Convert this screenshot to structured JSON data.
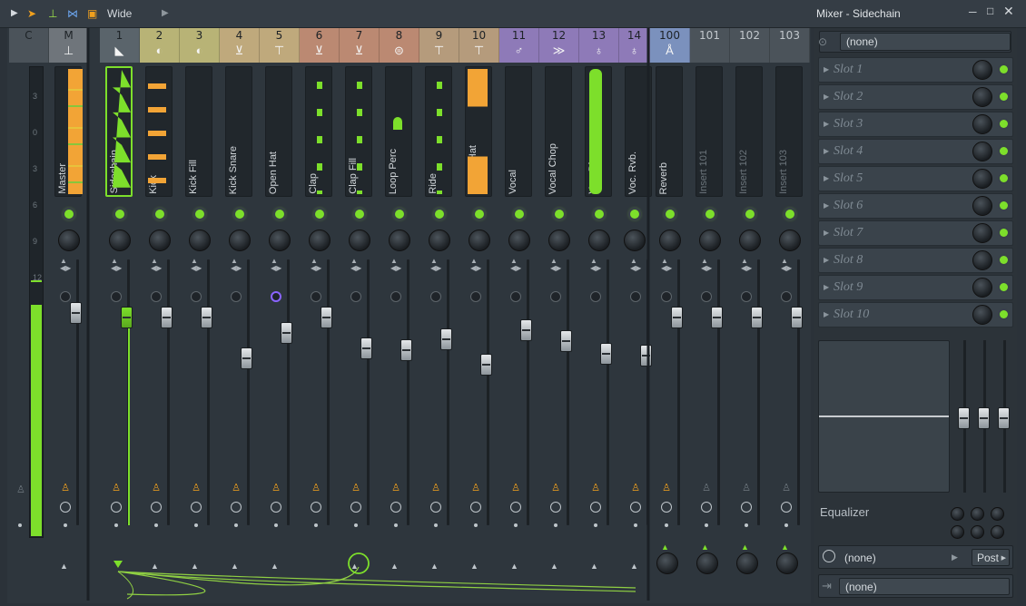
{
  "toolbar": {
    "view_mode": "Wide",
    "icons": [
      "play-arrow-icon",
      "pointer-arrow-icon",
      "insert-icon",
      "bowtie-icon",
      "square-icon",
      "chevron-right-icon"
    ]
  },
  "window": {
    "title": "Mixer - Sidechain",
    "controls": [
      "minimize-icon",
      "maximize-icon",
      "close-icon"
    ]
  },
  "colors": {
    "accent_green": "#7ddf2b",
    "meter_orange": "#f2a436",
    "group_yellow": "#b8b376",
    "group_gold": "#bfa97c",
    "group_salmon": "#bb8972",
    "group_tan": "#b59b7c",
    "group_purple": "#8e7ab8",
    "group_blue": "#7b91bd"
  },
  "strips": [
    {
      "num": "C",
      "name": "",
      "color": "#4b535a",
      "icon": ""
    },
    {
      "num": "M",
      "name": "Master",
      "color": "#6f757b",
      "icon": "⊥"
    },
    {
      "num": "1",
      "name": "Sidechain",
      "color": "#5a646b",
      "icon": "◣"
    },
    {
      "num": "2",
      "name": "Kick",
      "color": "#b8b376",
      "icon": "◐"
    },
    {
      "num": "3",
      "name": "Kick Fill",
      "color": "#b8b376",
      "icon": "◐"
    },
    {
      "num": "4",
      "name": "Kick Snare",
      "color": "#bfa97c",
      "icon": "⊻"
    },
    {
      "num": "5",
      "name": "Open Hat",
      "color": "#bfa97c",
      "icon": "⊤"
    },
    {
      "num": "6",
      "name": "Clap",
      "color": "#bb8972",
      "icon": "⊻"
    },
    {
      "num": "7",
      "name": "Clap Fill",
      "color": "#bb8972",
      "icon": "⊻"
    },
    {
      "num": "8",
      "name": "Loop Perc",
      "color": "#bb8972",
      "icon": "⊜"
    },
    {
      "num": "9",
      "name": "Ride",
      "color": "#b59b7c",
      "icon": "⊤"
    },
    {
      "num": "10",
      "name": "Closed Hat",
      "color": "#b59b7c",
      "icon": "⊤"
    },
    {
      "num": "11",
      "name": "Vocal",
      "color": "#8e7ab8",
      "icon": "♂"
    },
    {
      "num": "12",
      "name": "Vocal Chop",
      "color": "#8e7ab8",
      "icon": "≫"
    },
    {
      "num": "13",
      "name": "Voc. Dly.",
      "color": "#8e7ab8",
      "icon": "♁"
    },
    {
      "num": "14",
      "name": "Voc. Rvb.",
      "color": "#8e7ab8",
      "icon": "♁"
    },
    {
      "num": "100",
      "name": "Reverb",
      "color": "#7b91bd",
      "icon": "Å"
    },
    {
      "num": "101",
      "name": "Insert 101",
      "color": "#4b535a",
      "icon": ""
    },
    {
      "num": "102",
      "name": "Insert 102",
      "color": "#4b535a",
      "icon": ""
    },
    {
      "num": "103",
      "name": "Insert 103",
      "color": "#4b535a",
      "icon": ""
    }
  ],
  "master_scale": [
    "3",
    "0",
    "3",
    "6",
    "9",
    "12"
  ],
  "panel": {
    "input": "(none)",
    "slots": [
      "Slot 1",
      "Slot 2",
      "Slot 3",
      "Slot 4",
      "Slot 5",
      "Slot 6",
      "Slot 7",
      "Slot 8",
      "Slot 9",
      "Slot 10"
    ],
    "eq_label": "Equalizer",
    "routing_target": "(none)",
    "post_label": "Post",
    "output": "(none)"
  }
}
